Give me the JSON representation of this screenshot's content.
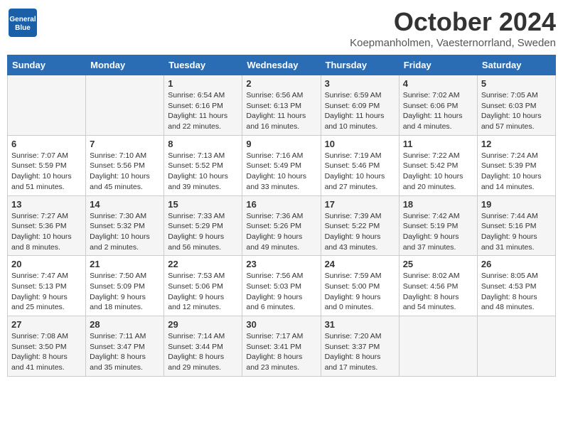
{
  "header": {
    "logo_general": "General",
    "logo_blue": "Blue",
    "title": "October 2024",
    "location": "Koepmanholmen, Vaesternorrland, Sweden"
  },
  "days_of_week": [
    "Sunday",
    "Monday",
    "Tuesday",
    "Wednesday",
    "Thursday",
    "Friday",
    "Saturday"
  ],
  "weeks": [
    [
      {
        "day": "",
        "info": ""
      },
      {
        "day": "",
        "info": ""
      },
      {
        "day": "1",
        "info": "Sunrise: 6:54 AM\nSunset: 6:16 PM\nDaylight: 11 hours\nand 22 minutes."
      },
      {
        "day": "2",
        "info": "Sunrise: 6:56 AM\nSunset: 6:13 PM\nDaylight: 11 hours\nand 16 minutes."
      },
      {
        "day": "3",
        "info": "Sunrise: 6:59 AM\nSunset: 6:09 PM\nDaylight: 11 hours\nand 10 minutes."
      },
      {
        "day": "4",
        "info": "Sunrise: 7:02 AM\nSunset: 6:06 PM\nDaylight: 11 hours\nand 4 minutes."
      },
      {
        "day": "5",
        "info": "Sunrise: 7:05 AM\nSunset: 6:03 PM\nDaylight: 10 hours\nand 57 minutes."
      }
    ],
    [
      {
        "day": "6",
        "info": "Sunrise: 7:07 AM\nSunset: 5:59 PM\nDaylight: 10 hours\nand 51 minutes."
      },
      {
        "day": "7",
        "info": "Sunrise: 7:10 AM\nSunset: 5:56 PM\nDaylight: 10 hours\nand 45 minutes."
      },
      {
        "day": "8",
        "info": "Sunrise: 7:13 AM\nSunset: 5:52 PM\nDaylight: 10 hours\nand 39 minutes."
      },
      {
        "day": "9",
        "info": "Sunrise: 7:16 AM\nSunset: 5:49 PM\nDaylight: 10 hours\nand 33 minutes."
      },
      {
        "day": "10",
        "info": "Sunrise: 7:19 AM\nSunset: 5:46 PM\nDaylight: 10 hours\nand 27 minutes."
      },
      {
        "day": "11",
        "info": "Sunrise: 7:22 AM\nSunset: 5:42 PM\nDaylight: 10 hours\nand 20 minutes."
      },
      {
        "day": "12",
        "info": "Sunrise: 7:24 AM\nSunset: 5:39 PM\nDaylight: 10 hours\nand 14 minutes."
      }
    ],
    [
      {
        "day": "13",
        "info": "Sunrise: 7:27 AM\nSunset: 5:36 PM\nDaylight: 10 hours\nand 8 minutes."
      },
      {
        "day": "14",
        "info": "Sunrise: 7:30 AM\nSunset: 5:32 PM\nDaylight: 10 hours\nand 2 minutes."
      },
      {
        "day": "15",
        "info": "Sunrise: 7:33 AM\nSunset: 5:29 PM\nDaylight: 9 hours\nand 56 minutes."
      },
      {
        "day": "16",
        "info": "Sunrise: 7:36 AM\nSunset: 5:26 PM\nDaylight: 9 hours\nand 49 minutes."
      },
      {
        "day": "17",
        "info": "Sunrise: 7:39 AM\nSunset: 5:22 PM\nDaylight: 9 hours\nand 43 minutes."
      },
      {
        "day": "18",
        "info": "Sunrise: 7:42 AM\nSunset: 5:19 PM\nDaylight: 9 hours\nand 37 minutes."
      },
      {
        "day": "19",
        "info": "Sunrise: 7:44 AM\nSunset: 5:16 PM\nDaylight: 9 hours\nand 31 minutes."
      }
    ],
    [
      {
        "day": "20",
        "info": "Sunrise: 7:47 AM\nSunset: 5:13 PM\nDaylight: 9 hours\nand 25 minutes."
      },
      {
        "day": "21",
        "info": "Sunrise: 7:50 AM\nSunset: 5:09 PM\nDaylight: 9 hours\nand 18 minutes."
      },
      {
        "day": "22",
        "info": "Sunrise: 7:53 AM\nSunset: 5:06 PM\nDaylight: 9 hours\nand 12 minutes."
      },
      {
        "day": "23",
        "info": "Sunrise: 7:56 AM\nSunset: 5:03 PM\nDaylight: 9 hours\nand 6 minutes."
      },
      {
        "day": "24",
        "info": "Sunrise: 7:59 AM\nSunset: 5:00 PM\nDaylight: 9 hours\nand 0 minutes."
      },
      {
        "day": "25",
        "info": "Sunrise: 8:02 AM\nSunset: 4:56 PM\nDaylight: 8 hours\nand 54 minutes."
      },
      {
        "day": "26",
        "info": "Sunrise: 8:05 AM\nSunset: 4:53 PM\nDaylight: 8 hours\nand 48 minutes."
      }
    ],
    [
      {
        "day": "27",
        "info": "Sunrise: 7:08 AM\nSunset: 3:50 PM\nDaylight: 8 hours\nand 41 minutes."
      },
      {
        "day": "28",
        "info": "Sunrise: 7:11 AM\nSunset: 3:47 PM\nDaylight: 8 hours\nand 35 minutes."
      },
      {
        "day": "29",
        "info": "Sunrise: 7:14 AM\nSunset: 3:44 PM\nDaylight: 8 hours\nand 29 minutes."
      },
      {
        "day": "30",
        "info": "Sunrise: 7:17 AM\nSunset: 3:41 PM\nDaylight: 8 hours\nand 23 minutes."
      },
      {
        "day": "31",
        "info": "Sunrise: 7:20 AM\nSunset: 3:37 PM\nDaylight: 8 hours\nand 17 minutes."
      },
      {
        "day": "",
        "info": ""
      },
      {
        "day": "",
        "info": ""
      }
    ]
  ]
}
